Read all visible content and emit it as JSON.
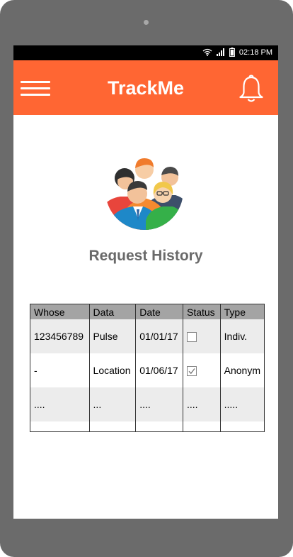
{
  "status_bar": {
    "time": "02:18 PM"
  },
  "app_bar": {
    "title": "TrackMe"
  },
  "section": {
    "title": "Request History"
  },
  "table": {
    "headers": [
      "Whose",
      "Data",
      "Date",
      "Status",
      "Type"
    ],
    "rows": [
      {
        "whose": "123456789",
        "data": "Pulse",
        "date": "01/01/17",
        "status_checked": false,
        "type": "Indiv."
      },
      {
        "whose": "-",
        "data": "Location",
        "date": "01/06/17",
        "status_checked": true,
        "type": "Anonym"
      },
      {
        "whose": "....",
        "data": "...",
        "date": "....",
        "status": "....",
        "type": "....."
      }
    ]
  },
  "icons": [
    "wifi-icon",
    "signal-icon",
    "battery-icon",
    "menu-icon",
    "bell-icon",
    "group-people-icon",
    "checkbox-icon",
    "checkmark-icon"
  ],
  "colors": {
    "accent": "#ff6633",
    "header_gray": "#a4a4a4",
    "stripe": "#ececec",
    "title_gray": "#6a6a6a",
    "device_frame": "#6b6b6b"
  }
}
